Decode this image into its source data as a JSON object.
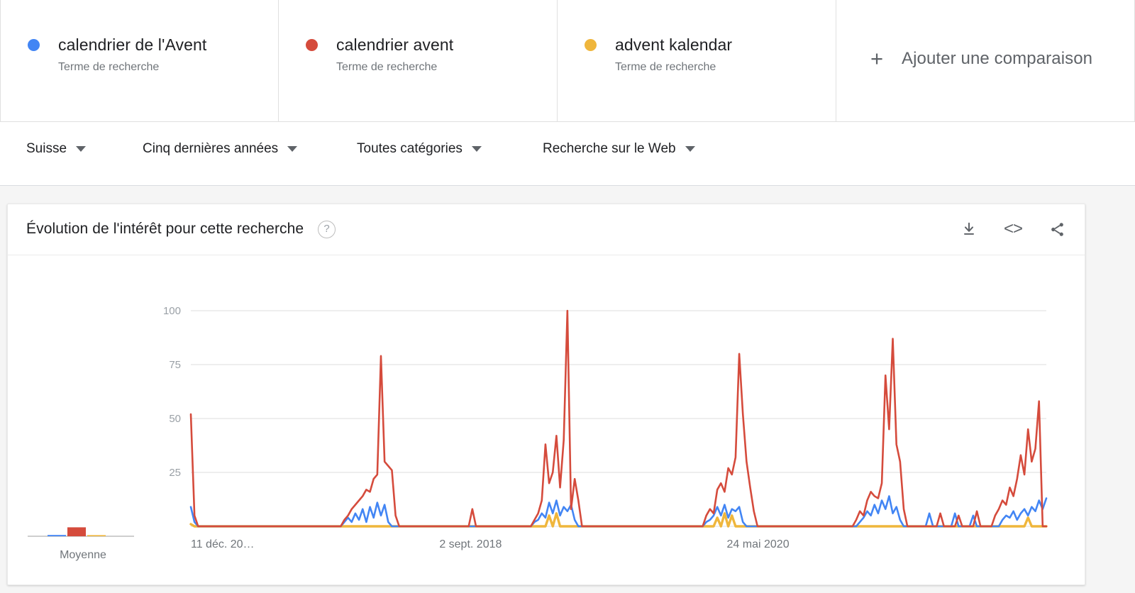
{
  "terms": [
    {
      "label": "calendrier de l'Avent",
      "sublabel": "Terme de recherche",
      "color": "#4285F4"
    },
    {
      "label": "calendrier avent",
      "sublabel": "Terme de recherche",
      "color": "#D54B3C"
    },
    {
      "label": "advent kalendar",
      "sublabel": "Terme de recherche",
      "color": "#EFB63C"
    }
  ],
  "add_comparison": {
    "label": "Ajouter une comparaison",
    "plus": "+"
  },
  "filters": [
    {
      "name": "region",
      "value": "Suisse"
    },
    {
      "name": "time",
      "value": "Cinq dernières années"
    },
    {
      "name": "category",
      "value": "Toutes catégories"
    },
    {
      "name": "search",
      "value": "Recherche sur le Web"
    }
  ],
  "card": {
    "title": "Évolution de l'intérêt pour cette recherche",
    "help": "?",
    "actions": [
      {
        "name": "download",
        "icon": "download-icon"
      },
      {
        "name": "embed",
        "icon": "embed-icon",
        "glyph": "<>"
      },
      {
        "name": "share",
        "icon": "share-icon"
      }
    ]
  },
  "average_panel": {
    "label": "Moyenne",
    "values": [
      2,
      14,
      1
    ]
  },
  "chart_data": {
    "type": "line",
    "title": "Évolution de l'intérêt pour cette recherche",
    "xlabel": "",
    "ylabel": "",
    "ylim": [
      0,
      100
    ],
    "yticks": [
      25,
      50,
      75,
      100
    ],
    "grid": true,
    "legend_position": "top",
    "xtick_labels": [
      "11 déc. 20…",
      "2 sept. 2018",
      "24 mai 2020"
    ],
    "xtick_positions": [
      0.0,
      0.327,
      0.663
    ],
    "series": [
      {
        "name": "calendrier de l'Avent",
        "color": "#4285F4",
        "values": [
          9,
          2,
          0,
          0,
          0,
          0,
          0,
          0,
          0,
          0,
          0,
          0,
          0,
          0,
          0,
          0,
          0,
          0,
          0,
          0,
          0,
          0,
          0,
          0,
          0,
          0,
          0,
          0,
          0,
          0,
          0,
          0,
          0,
          0,
          0,
          0,
          0,
          0,
          0,
          0,
          0,
          0,
          2,
          4,
          2,
          6,
          3,
          8,
          2,
          9,
          4,
          11,
          5,
          10,
          2,
          0,
          0,
          0,
          0,
          0,
          0,
          0,
          0,
          0,
          0,
          0,
          0,
          0,
          0,
          0,
          0,
          0,
          0,
          0,
          0,
          0,
          0,
          0,
          0,
          0,
          0,
          0,
          0,
          0,
          0,
          0,
          0,
          0,
          0,
          0,
          0,
          0,
          0,
          0,
          2,
          3,
          6,
          4,
          11,
          6,
          12,
          5,
          9,
          7,
          10,
          3,
          0,
          0,
          0,
          0,
          0,
          0,
          0,
          0,
          0,
          0,
          0,
          0,
          0,
          0,
          0,
          0,
          0,
          0,
          0,
          0,
          0,
          0,
          0,
          0,
          0,
          0,
          0,
          0,
          0,
          0,
          0,
          0,
          0,
          0,
          0,
          2,
          3,
          5,
          9,
          5,
          10,
          4,
          8,
          7,
          9,
          2,
          0,
          0,
          0,
          0,
          0,
          0,
          0,
          0,
          0,
          0,
          0,
          0,
          0,
          0,
          0,
          0,
          0,
          0,
          0,
          0,
          0,
          0,
          0,
          0,
          0,
          0,
          0,
          0,
          0,
          0,
          0,
          2,
          4,
          7,
          5,
          10,
          6,
          12,
          8,
          14,
          6,
          9,
          3,
          0,
          0,
          0,
          0,
          0,
          0,
          0,
          6,
          0,
          0,
          0,
          0,
          0,
          0,
          6,
          0,
          0,
          0,
          0,
          5,
          0,
          0,
          0,
          0,
          0,
          0,
          0,
          3,
          5,
          4,
          7,
          3,
          6,
          8,
          5,
          9,
          7,
          12,
          8,
          13
        ]
      },
      {
        "name": "calendrier avent",
        "color": "#D54B3C",
        "values": [
          52,
          5,
          0,
          0,
          0,
          0,
          0,
          0,
          0,
          0,
          0,
          0,
          0,
          0,
          0,
          0,
          0,
          0,
          0,
          0,
          0,
          0,
          0,
          0,
          0,
          0,
          0,
          0,
          0,
          0,
          0,
          0,
          0,
          0,
          0,
          0,
          0,
          0,
          0,
          0,
          0,
          0,
          3,
          5,
          8,
          10,
          12,
          14,
          17,
          16,
          22,
          24,
          79,
          30,
          28,
          26,
          5,
          0,
          0,
          0,
          0,
          0,
          0,
          0,
          0,
          0,
          0,
          0,
          0,
          0,
          0,
          0,
          0,
          0,
          0,
          0,
          0,
          8,
          0,
          0,
          0,
          0,
          0,
          0,
          0,
          0,
          0,
          0,
          0,
          0,
          0,
          0,
          0,
          0,
          3,
          6,
          12,
          38,
          20,
          25,
          42,
          18,
          40,
          100,
          8,
          22,
          12,
          0,
          0,
          0,
          0,
          0,
          0,
          0,
          0,
          0,
          0,
          0,
          0,
          0,
          0,
          0,
          0,
          0,
          0,
          0,
          0,
          0,
          0,
          0,
          0,
          0,
          0,
          0,
          0,
          0,
          0,
          0,
          0,
          0,
          0,
          5,
          8,
          6,
          17,
          20,
          16,
          27,
          24,
          32,
          80,
          52,
          30,
          18,
          7,
          0,
          0,
          0,
          0,
          0,
          0,
          0,
          0,
          0,
          0,
          0,
          0,
          0,
          0,
          0,
          0,
          0,
          0,
          0,
          0,
          0,
          0,
          0,
          0,
          0,
          0,
          0,
          3,
          7,
          5,
          12,
          16,
          14,
          13,
          20,
          70,
          45,
          87,
          38,
          30,
          8,
          0,
          0,
          0,
          0,
          0,
          0,
          0,
          0,
          0,
          6,
          0,
          0,
          0,
          0,
          5,
          0,
          0,
          0,
          0,
          7,
          0,
          0,
          0,
          0,
          5,
          8,
          12,
          10,
          18,
          14,
          22,
          33,
          24,
          45,
          30,
          36,
          58,
          0,
          0
        ]
      },
      {
        "name": "advent kalendar",
        "color": "#EFB63C",
        "values": [
          1,
          0,
          0,
          0,
          0,
          0,
          0,
          0,
          0,
          0,
          0,
          0,
          0,
          0,
          0,
          0,
          0,
          0,
          0,
          0,
          0,
          0,
          0,
          0,
          0,
          0,
          0,
          0,
          0,
          0,
          0,
          0,
          0,
          0,
          0,
          0,
          0,
          0,
          0,
          0,
          0,
          0,
          0,
          0,
          0,
          0,
          0,
          0,
          0,
          0,
          0,
          0,
          0,
          0,
          0,
          0,
          0,
          0,
          0,
          0,
          0,
          0,
          0,
          0,
          0,
          0,
          0,
          0,
          0,
          0,
          0,
          0,
          0,
          0,
          0,
          0,
          0,
          0,
          0,
          0,
          0,
          0,
          0,
          0,
          0,
          0,
          0,
          0,
          0,
          0,
          0,
          0,
          0,
          0,
          0,
          0,
          0,
          0,
          5,
          0,
          6,
          0,
          0,
          0,
          0,
          0,
          0,
          0,
          0,
          0,
          0,
          0,
          0,
          0,
          0,
          0,
          0,
          0,
          0,
          0,
          0,
          0,
          0,
          0,
          0,
          0,
          0,
          0,
          0,
          0,
          0,
          0,
          0,
          0,
          0,
          0,
          0,
          0,
          0,
          0,
          0,
          0,
          0,
          0,
          4,
          0,
          6,
          0,
          5,
          0,
          0,
          0,
          0,
          0,
          0,
          0,
          0,
          0,
          0,
          0,
          0,
          0,
          0,
          0,
          0,
          0,
          0,
          0,
          0,
          0,
          0,
          0,
          0,
          0,
          0,
          0,
          0,
          0,
          0,
          0,
          0,
          0,
          0,
          0,
          0,
          0,
          0,
          0,
          0,
          0,
          0,
          0,
          0,
          0,
          0,
          0,
          0,
          0,
          0,
          0,
          0,
          0,
          0,
          0,
          0,
          0,
          0,
          0,
          0,
          0,
          0,
          0,
          0,
          0,
          0,
          0,
          0,
          0,
          0,
          0,
          0,
          0,
          0,
          0,
          0,
          0,
          0,
          0,
          0,
          4,
          0,
          0,
          0,
          0,
          0
        ]
      }
    ]
  }
}
